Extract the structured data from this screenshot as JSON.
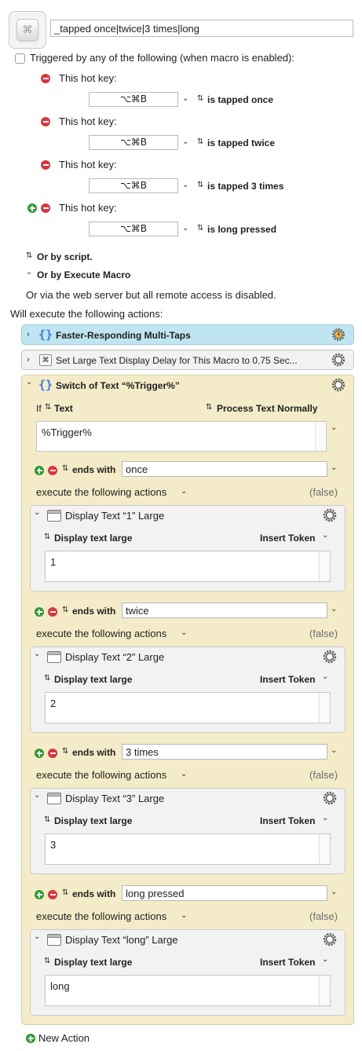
{
  "macro": {
    "name": "_tapped once|twice|3 times|long"
  },
  "triggers": {
    "header": "Triggered by any of the following (when macro is enabled):",
    "hotkeys": [
      {
        "label": "This hot key:",
        "key": "⌥⌘B",
        "mode": "is tapped once"
      },
      {
        "label": "This hot key:",
        "key": "⌥⌘B",
        "mode": "is tapped twice"
      },
      {
        "label": "This hot key:",
        "key": "⌥⌘B",
        "mode": "is tapped 3 times"
      },
      {
        "label": "This hot key:",
        "key": "⌥⌘B",
        "mode": "is long pressed"
      }
    ],
    "or_by_script": "Or by script.",
    "or_by_execute_macro": "Or by Execute Macro",
    "web_server_note": "Or via the web server but all remote access is disabled."
  },
  "actions": {
    "header": "Will execute the following actions:",
    "group": {
      "title": "Faster-Responding Multi-Taps"
    },
    "set_delay": {
      "title": "Set Large Text Display Delay for This Macro to 0.75 Sec..."
    },
    "switch": {
      "title": "Switch of Text “%Trigger%”",
      "if_label": "If",
      "source": "Text",
      "processing": "Process Text Normally",
      "text_value": "%Trigger%",
      "execute_label": "execute the following actions",
      "false_label": "(false)",
      "cases": [
        {
          "condition": "ends with",
          "value": "once",
          "action_title": "Display Text “1” Large",
          "field_label": "Display text large",
          "insert_token": "Insert Token",
          "text": "1"
        },
        {
          "condition": "ends with",
          "value": "twice",
          "action_title": "Display Text “2” Large",
          "field_label": "Display text large",
          "insert_token": "Insert Token",
          "text": "2"
        },
        {
          "condition": "ends with",
          "value": "3 times",
          "action_title": "Display Text “3” Large",
          "field_label": "Display text large",
          "insert_token": "Insert Token",
          "text": "3"
        },
        {
          "condition": "ends with",
          "value": "long pressed",
          "action_title": "Display Text “long” Large",
          "field_label": "Display text large",
          "insert_token": "Insert Token",
          "text": "long"
        }
      ]
    },
    "new_action": "New Action"
  },
  "colors": {
    "group_bg": "#bfe6f0",
    "switch_bg": "#f4ecc8",
    "card_bg": "#f2f2f2",
    "minus": "#d9363e",
    "plus": "#2e9b35",
    "braces": "#3b78e7"
  },
  "icons": {
    "macro": "macro-clipboard-icon",
    "gear": "gear-icon",
    "timer_gear": "clock-gear-icon",
    "braces": "braces-icon",
    "window": "window-icon"
  }
}
